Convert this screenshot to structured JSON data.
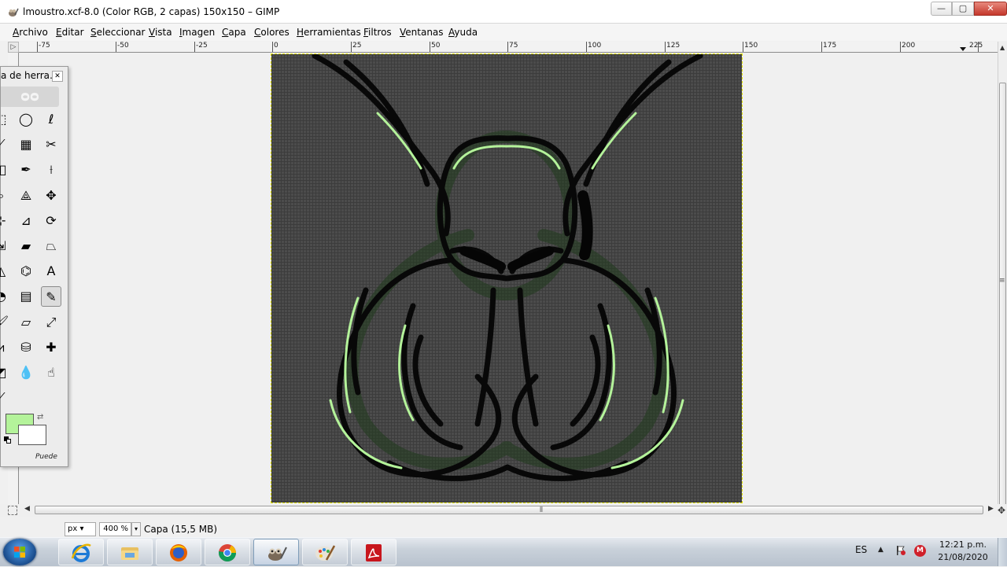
{
  "window": {
    "title": "lmoustro.xcf-8.0 (Color RGB, 2 capas) 150x150 – GIMP",
    "min_label": "—",
    "max_label": "▢",
    "close_label": "✕"
  },
  "menubar": {
    "items": [
      "Archivo",
      "Editar",
      "Seleccionar",
      "Vista",
      "Imagen",
      "Capa",
      "Colores",
      "Herramientas",
      "Filtros",
      "Ventanas",
      "Ayuda"
    ]
  },
  "ruler": {
    "corner_label": "▷",
    "horizontal_labels": [
      "-75",
      "-50",
      "-25",
      "0",
      "25",
      "50",
      "75",
      "100",
      "125",
      "150",
      "175",
      "200",
      "225"
    ]
  },
  "toolbox": {
    "title": "a de herra…",
    "close_label": "✕",
    "header_logo": "ᴑᴑ",
    "tools": [
      {
        "name": "rect-select-icon",
        "glyph": "⬚"
      },
      {
        "name": "ellipse-select-icon",
        "glyph": "◯"
      },
      {
        "name": "free-select-icon",
        "glyph": "ℓ"
      },
      {
        "name": "fuzzy-select-icon",
        "glyph": "⟋"
      },
      {
        "name": "select-by-color-icon",
        "glyph": "▦"
      },
      {
        "name": "scissors-icon",
        "glyph": "✂"
      },
      {
        "name": "foreground-select-icon",
        "glyph": "◧"
      },
      {
        "name": "paths-icon",
        "glyph": "✒"
      },
      {
        "name": "color-picker-icon",
        "glyph": "⟊"
      },
      {
        "name": "zoom-icon",
        "glyph": "⌕"
      },
      {
        "name": "measure-icon",
        "glyph": "⟁"
      },
      {
        "name": "move-icon",
        "glyph": "✥"
      },
      {
        "name": "align-icon",
        "glyph": "⊹"
      },
      {
        "name": "crop-icon",
        "glyph": "⊿"
      },
      {
        "name": "rotate-icon",
        "glyph": "⟳"
      },
      {
        "name": "scale-icon",
        "glyph": "⇲"
      },
      {
        "name": "shear-icon",
        "glyph": "▰"
      },
      {
        "name": "perspective-icon",
        "glyph": "⏢"
      },
      {
        "name": "flip-icon",
        "glyph": "◭"
      },
      {
        "name": "cage-icon",
        "glyph": "⌬"
      },
      {
        "name": "text-icon",
        "glyph": "A"
      },
      {
        "name": "bucket-fill-icon",
        "glyph": "◔"
      },
      {
        "name": "blend-icon",
        "glyph": "▤"
      },
      {
        "name": "pencil-icon",
        "glyph": "✎"
      },
      {
        "name": "paintbrush-icon",
        "glyph": "🖌"
      },
      {
        "name": "eraser-icon",
        "glyph": "▱"
      },
      {
        "name": "airbrush-icon",
        "glyph": "⤢"
      },
      {
        "name": "ink-icon",
        "glyph": "⩘"
      },
      {
        "name": "clone-icon",
        "glyph": "⛁"
      },
      {
        "name": "heal-icon",
        "glyph": "✚"
      },
      {
        "name": "perspective-clone-icon",
        "glyph": "◩"
      },
      {
        "name": "blur-icon",
        "glyph": "💧"
      },
      {
        "name": "smudge-icon",
        "glyph": "☝"
      },
      {
        "name": "dodge-burn-icon",
        "glyph": "⟋"
      }
    ],
    "fg_color": "#b4f39a",
    "bg_color": "#ffffff",
    "hint": "Puede"
  },
  "statusbar": {
    "unit": "px",
    "unit_arrow": "▾",
    "zoom": "400 %",
    "zoom_arrow": "▾",
    "status": "Capa (15,5 MB)"
  },
  "taskbar": {
    "apps": [
      "internet-explorer-icon",
      "file-explorer-icon",
      "firefox-icon",
      "chrome-icon",
      "gimp-icon",
      "paint-icon",
      "acrobat-icon"
    ],
    "language": "ES",
    "tray_arrow": "▲",
    "av_label": "M",
    "time": "12:21 p.m.",
    "date": "21/08/2020"
  }
}
